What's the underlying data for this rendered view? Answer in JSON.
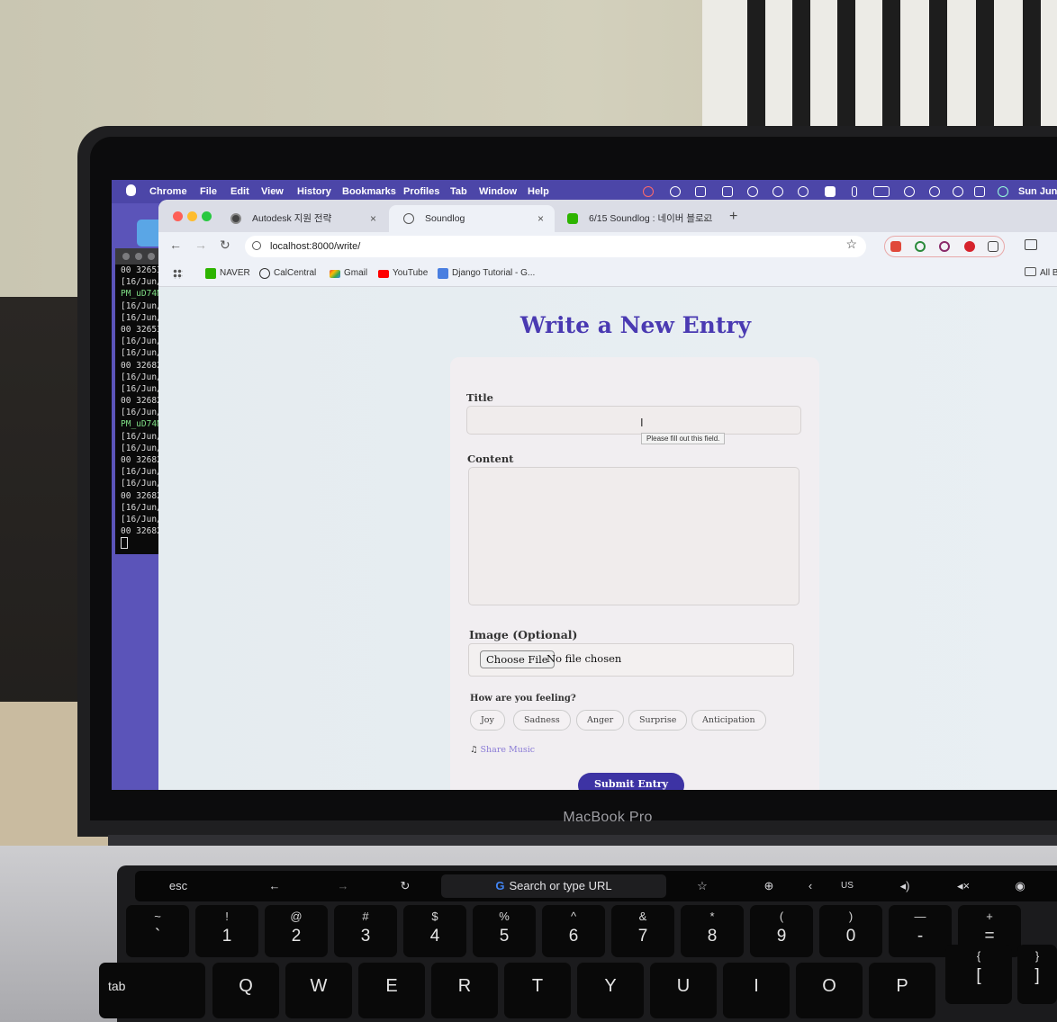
{
  "menubar": {
    "app": "Chrome",
    "items": [
      "File",
      "Edit",
      "View",
      "History",
      "Bookmarks",
      "Profiles",
      "Tab",
      "Window",
      "Help"
    ],
    "clock": "Sun Jun"
  },
  "terminal": {
    "lines": [
      "00 32653",
      "[16/Jun/",
      "PM_uD74N",
      "[16/Jun/",
      "[16/Jun/",
      "00 32653",
      "[16/Jun/",
      "[16/Jun/",
      "00 32682",
      "[16/Jun/",
      "[16/Jun/",
      "00 32682",
      "[16/Jun/",
      "PM_uD74N",
      "[16/Jun/",
      "[16/Jun/",
      "00 32682",
      "[16/Jun/",
      "[16/Jun/",
      "00 32682",
      "[16/Jun/",
      "[16/Jun/",
      "00 32682"
    ]
  },
  "browser": {
    "tabs": [
      {
        "title": "Autodesk 지원 전략",
        "close": "×"
      },
      {
        "title": "Soundlog",
        "close": "×"
      },
      {
        "title": "6/15 Soundlog : 네이버 블로그",
        "close": "×"
      }
    ],
    "new_tab": "+",
    "url": "localhost:8000/write/",
    "bookmarks": [
      "NAVER",
      "CalCentral",
      "Gmail",
      "YouTube",
      "Django Tutorial - G..."
    ],
    "all_bookmarks": "All B",
    "accent": "#4a3ab2"
  },
  "page": {
    "title": "Write a New Entry",
    "title_label": "Title",
    "validation_tooltip": "Please fill out this field.",
    "content_label": "Content",
    "image_label": "Image (Optional)",
    "choose_file": "Choose File",
    "no_file": "No file chosen",
    "feeling_label": "How are you feeling?",
    "emotions": [
      "Joy",
      "Sadness",
      "Anger",
      "Surprise",
      "Anticipation"
    ],
    "share_music": "Share Music",
    "submit": "Submit Entry"
  },
  "laptop": {
    "brand": "MacBook Pro",
    "touchbar": {
      "esc": "esc",
      "search": "Search or type URL",
      "lang": "US"
    },
    "number_row": [
      {
        "top": "~",
        "bottom": "`"
      },
      {
        "top": "!",
        "bottom": "1"
      },
      {
        "top": "@",
        "bottom": "2"
      },
      {
        "top": "#",
        "bottom": "3"
      },
      {
        "top": "$",
        "bottom": "4"
      },
      {
        "top": "%",
        "bottom": "5"
      },
      {
        "top": "^",
        "bottom": "6"
      },
      {
        "top": "&",
        "bottom": "7"
      },
      {
        "top": "*",
        "bottom": "8"
      },
      {
        "top": "(",
        "bottom": "9"
      },
      {
        "top": ")",
        "bottom": "0"
      },
      {
        "top": "—",
        "bottom": "-"
      },
      {
        "top": "+",
        "bottom": "="
      }
    ],
    "letter_row": [
      "tab",
      "Q",
      "W",
      "E",
      "R",
      "T",
      "Y",
      "U",
      "I",
      "O",
      "P"
    ],
    "bracket_keys": [
      {
        "top": "{",
        "bottom": "["
      },
      {
        "top": "}",
        "bottom": "]"
      }
    ]
  }
}
